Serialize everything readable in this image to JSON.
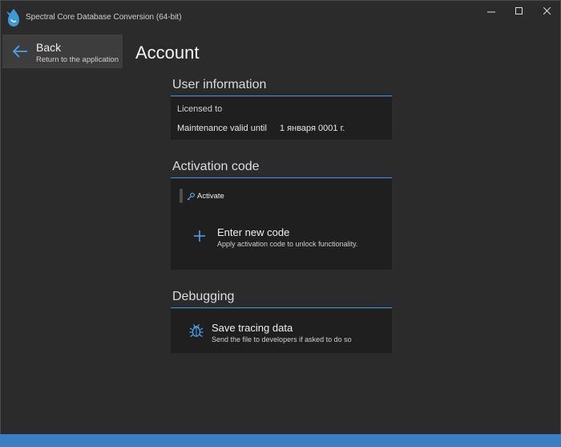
{
  "window": {
    "title": "Spectral Core Database Conversion (64-bit)",
    "controls": {
      "minimize": "—",
      "maximize": "☐",
      "close": "✕"
    }
  },
  "back": {
    "title": "Back",
    "subtitle": "Return to the application"
  },
  "page": {
    "title": "Account"
  },
  "user_information": {
    "header": "User information",
    "licensed_to_label": "Licensed to",
    "maintenance_label": "Maintenance valid until",
    "maintenance_value": "1 января 0001 г."
  },
  "activation_code": {
    "header": "Activation code",
    "activate_label": "Activate",
    "enter_code_title": "Enter new code",
    "enter_code_subtitle": "Apply activation code to unlock functionality."
  },
  "debugging": {
    "header": "Debugging",
    "save_tracing_title": "Save tracing data",
    "save_tracing_subtitle": "Send the file to developers if asked to do so"
  },
  "colors": {
    "accent": "#3b8de0",
    "statusbar": "#3b7ec4",
    "background": "#2b2b2b",
    "panel": "#1f1f1f"
  },
  "icons": [
    "app-logo-icon",
    "back-arrow-icon",
    "key-icon",
    "plus-icon",
    "bug-icon"
  ]
}
